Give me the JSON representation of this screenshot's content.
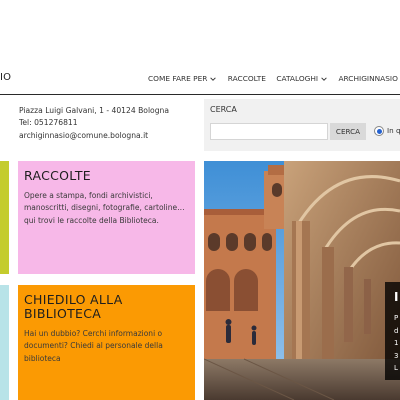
{
  "header": {
    "site_name": "IO"
  },
  "nav": {
    "items": [
      {
        "label": "COME FARE PER",
        "dropdown": true
      },
      {
        "label": "RACCOLTE",
        "dropdown": false
      },
      {
        "label": "CATALOGHI",
        "dropdown": true
      },
      {
        "label": "ARCHIGINNASIO DIG",
        "dropdown": false
      }
    ]
  },
  "contact": {
    "address": "Piazza Luigi Galvani, 1 - 40124 Bologna",
    "phone": "Tel: 051276811",
    "email": "archiginnasio@comune.bologna.it"
  },
  "search": {
    "title": "CERCA",
    "input_value": "",
    "button_label": "CERCA",
    "radio_label": "In q"
  },
  "tiles": {
    "raccolte": {
      "title": "RACCOLTE",
      "text_lines": [
        "Opere a stampa, fondi archivistici,",
        "manoscritti, disegni, fotografie, cartoline…",
        "qui trovi le raccolte della Biblioteca."
      ]
    },
    "chiedilo": {
      "title_lines": [
        "CHIEDILO ALLA",
        "BIBLIOTECA"
      ],
      "text_lines": [
        "Hai un dubbio? Cerchi informazioni o",
        "documenti? Chiedi al personale della",
        "biblioteca"
      ]
    }
  },
  "hero_overlay": {
    "title": "I",
    "lines": [
      "P",
      "d",
      "1",
      "3",
      "L"
    ]
  },
  "colors": {
    "raccolte_bg": "#f7b8e8",
    "chiedilo_bg": "#fb9a03",
    "lime_strip": "#c4cc2e",
    "cyan_strip": "#b8e3e8",
    "search_panel": "#f1f1f1"
  }
}
